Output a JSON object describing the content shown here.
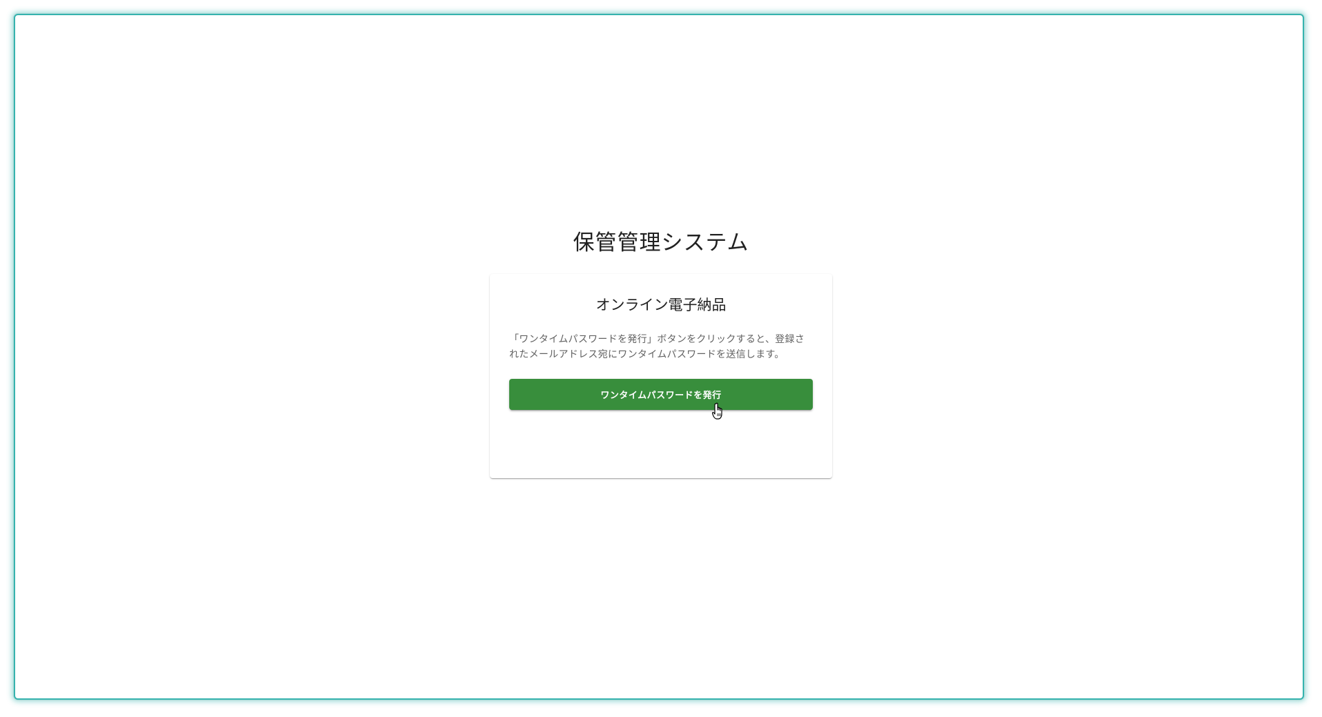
{
  "app": {
    "title": "保管管理システム"
  },
  "card": {
    "title": "オンライン電子納品",
    "description": "「ワンタイムパスワードを発行」ボタンをクリックすると、登録されたメールアドレス宛にワンタイムパスワードを送信します。",
    "button_label": "ワンタイムパスワードを発行"
  },
  "colors": {
    "primary_button": "#388e3c",
    "frame_border": "#35b3ae"
  },
  "icons": {
    "cursor": "hand-pointer-icon"
  }
}
